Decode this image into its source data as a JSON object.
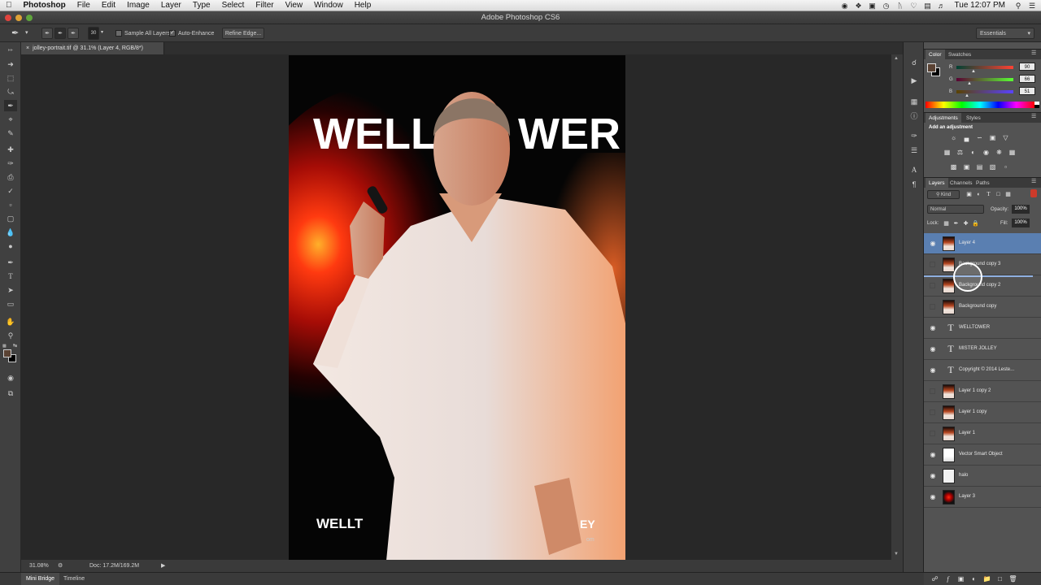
{
  "menubar": {
    "app": "Photoshop",
    "items": [
      "File",
      "Edit",
      "Image",
      "Layer",
      "Type",
      "Select",
      "Filter",
      "View",
      "Window",
      "Help"
    ],
    "clock": "Tue 12:07 PM"
  },
  "titlebar": {
    "title": "Adobe Photoshop CS6"
  },
  "options": {
    "brush_size": "30",
    "sample_all_layers": "Sample All Layers",
    "auto_enhance": "Auto-Enhance",
    "refine_edge": "Refine Edge...",
    "workspace": "Essentials"
  },
  "document": {
    "tab_label": "jolley-portrait.tif @ 31.1% (Layer 4, RGB/8*)",
    "poster_title_left": "WELL",
    "poster_title_right": "WER",
    "poster_bottom_left": "WELLT",
    "poster_bottom_right": "EY",
    "poster_small": "om"
  },
  "statusbar": {
    "zoom": "31.08%",
    "doc_size": "Doc: 17.2M/169.2M"
  },
  "bottom_tabs": [
    "Mini Bridge",
    "Timeline"
  ],
  "color_panel": {
    "tabs": [
      "Color",
      "Swatches"
    ],
    "r_label": "R",
    "g_label": "G",
    "b_label": "B",
    "r": "90",
    "g": "66",
    "b": "51",
    "foreground": "#5a4233",
    "background": "#000000"
  },
  "adjustments_panel": {
    "tabs": [
      "Adjustments",
      "Styles"
    ],
    "heading": "Add an adjustment"
  },
  "layers_panel": {
    "tabs": [
      "Layers",
      "Channels",
      "Paths"
    ],
    "filter": "Kind",
    "blend_mode": "Normal",
    "opacity_label": "Opacity:",
    "opacity": "100%",
    "lock_label": "Lock:",
    "fill_label": "Fill:",
    "fill": "100%",
    "layers": [
      {
        "name": "Layer 4",
        "kind": "image",
        "visible": true,
        "selected": true
      },
      {
        "name": "Background copy 3",
        "kind": "image",
        "visible": false,
        "selected": false
      },
      {
        "name": "Background copy 2",
        "kind": "image",
        "visible": false,
        "selected": false
      },
      {
        "name": "Background copy",
        "kind": "image",
        "visible": false,
        "selected": false
      },
      {
        "name": "WELLTOWER",
        "kind": "text",
        "visible": true,
        "selected": false
      },
      {
        "name": "MISTER JOLLEY",
        "kind": "text",
        "visible": true,
        "selected": false
      },
      {
        "name": "Copyright © 2014 Leste...",
        "kind": "text",
        "visible": true,
        "selected": false
      },
      {
        "name": "Layer 1 copy 2",
        "kind": "image",
        "visible": false,
        "selected": false
      },
      {
        "name": "Layer 1 copy",
        "kind": "image",
        "visible": false,
        "selected": false
      },
      {
        "name": "Layer 1",
        "kind": "image",
        "visible": false,
        "selected": false
      },
      {
        "name": "Vector Smart Object",
        "kind": "smart",
        "visible": true,
        "selected": false
      },
      {
        "name": "halo",
        "kind": "white",
        "visible": true,
        "selected": false
      },
      {
        "name": "Layer 3",
        "kind": "red",
        "visible": true,
        "selected": false
      }
    ]
  }
}
